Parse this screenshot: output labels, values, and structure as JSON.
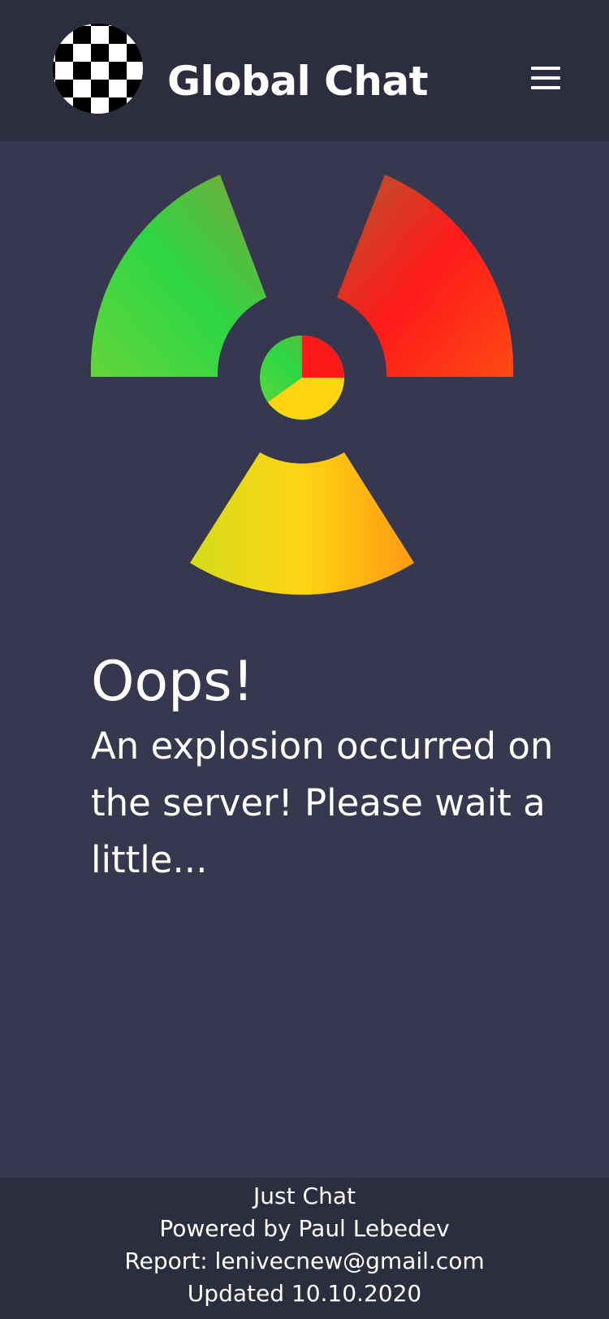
{
  "header": {
    "title": "Global Chat",
    "logo_icon": "checkerboard-logo-icon",
    "menu_icon": "hamburger-menu-icon"
  },
  "illustration": {
    "icon": "radiation-icon",
    "colors": {
      "left_blade": "#2ed644",
      "right_blade": "#ff1a1a",
      "bottom_blade": "#ffd413"
    }
  },
  "error": {
    "title": "Oops!",
    "message": "An explosion occurred on the server! Please wait a little..."
  },
  "footer": {
    "line1": "Just Chat",
    "line2": "Powered by Paul Lebedev",
    "line3": "Report:  lenivecnew@gmail.com",
    "line4": "Updated 10.10.2020"
  },
  "colors": {
    "page_background": "#37374f",
    "header_background": "#2d2d40",
    "footer_background": "#2d2d40",
    "text": "#ffffff"
  }
}
